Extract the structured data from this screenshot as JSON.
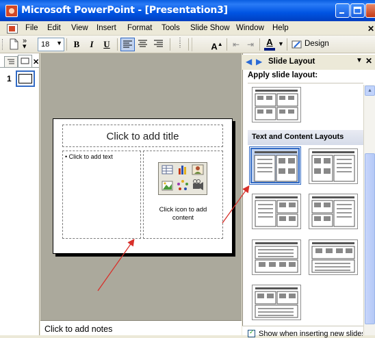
{
  "window": {
    "title": "Microsoft PowerPoint - [Presentation3]"
  },
  "menubar": {
    "items": [
      "File",
      "Edit",
      "View",
      "Insert",
      "Format",
      "Tools",
      "Slide Show",
      "Window",
      "Help"
    ]
  },
  "toolbar": {
    "font_size": "18",
    "bold": "B",
    "italic": "I",
    "underline": "U",
    "font_color_letter": "A",
    "design_label": "Design"
  },
  "left_pane": {
    "slide_number": "1"
  },
  "slide": {
    "title_placeholder": "Click to add title",
    "text_placeholder": "Click to add text",
    "content_placeholder_line1": "Click icon to add",
    "content_placeholder_line2": "content"
  },
  "notes": {
    "placeholder": "Click to add notes"
  },
  "task_pane": {
    "title": "Slide Layout",
    "apply_label": "Apply slide layout:",
    "section_label": "Text and Content Layouts",
    "show_checkbox_label": "Show when inserting new slides"
  },
  "colors": {
    "titlebar_blue": "#0054e3",
    "selection_blue": "#316ac5",
    "workspace_gray": "#aba99c",
    "arrow_red": "#d8302a"
  }
}
